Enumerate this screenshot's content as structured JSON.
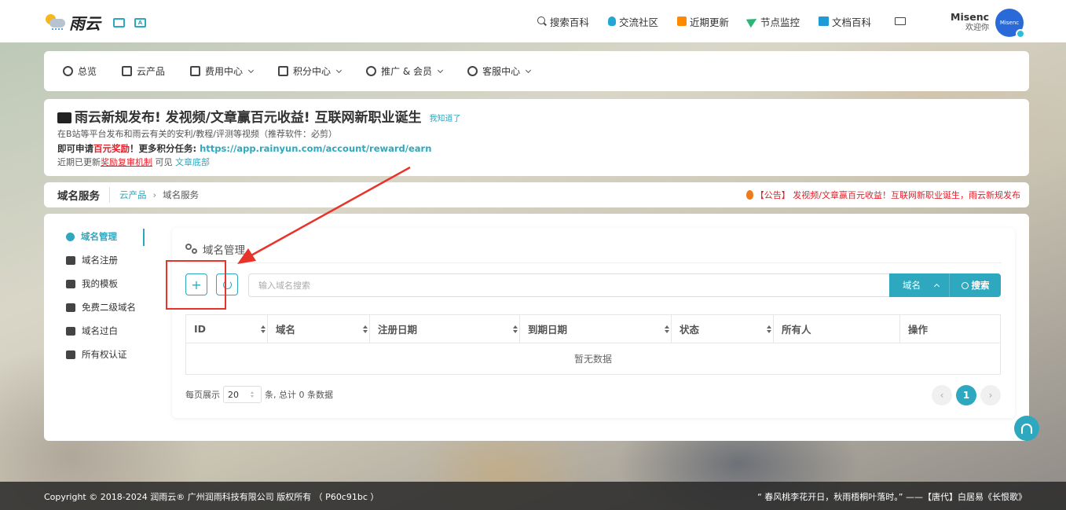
{
  "brand": {
    "name": "雨云"
  },
  "topnav": {
    "items": [
      {
        "label": "搜索百科",
        "icon": "search-icon"
      },
      {
        "label": "交流社区",
        "icon": "qq-icon"
      },
      {
        "label": "近期更新",
        "icon": "update-icon"
      },
      {
        "label": "节点监控",
        "icon": "send-icon"
      },
      {
        "label": "文档百科",
        "icon": "book-icon"
      }
    ],
    "mail_icon": "mail-icon"
  },
  "user": {
    "name": "Misenc",
    "greeting": "欢迎你",
    "avatar_text": "Misenc"
  },
  "mainnav": {
    "items": [
      {
        "label": "总览",
        "dropdown": false
      },
      {
        "label": "云产品",
        "dropdown": false
      },
      {
        "label": "费用中心",
        "dropdown": true
      },
      {
        "label": "积分中心",
        "dropdown": true
      },
      {
        "label": "推广 & 会员",
        "dropdown": true
      },
      {
        "label": "客服中心",
        "dropdown": true
      }
    ]
  },
  "notice": {
    "title": "雨云新规发布! 发视频/文章赢百元收益! 互联网新职业诞生",
    "dismiss": "我知道了",
    "line1": "在B站等平台发布和雨云有关的安利/教程/评测等视频（推荐软件：必剪）",
    "line2_a": "即可申请",
    "line2_red": "百元奖励",
    "line2_b": "！更多积分任务: ",
    "line2_link": "https://app.rainyun.com/account/reward/earn",
    "line3_a": "近期已更新",
    "line3_red": "奖励复审机制",
    "line3_b": " 可见 ",
    "line3_link": "文章底部"
  },
  "breadcrumb": {
    "title": "域名服务",
    "parent": "云产品",
    "separator": "›",
    "current": "域名服务",
    "announcement": "【公告】 发视频/文章赢百元收益！互联网新职业诞生，雨云新规发布"
  },
  "sidemenu": {
    "items": [
      {
        "label": "域名管理",
        "active": true
      },
      {
        "label": "域名注册",
        "active": false
      },
      {
        "label": "我的模板",
        "active": false
      },
      {
        "label": "免费二级域名",
        "active": false
      },
      {
        "label": "域名过白",
        "active": false
      },
      {
        "label": "所有权认证",
        "active": false
      }
    ]
  },
  "panel": {
    "title": "域名管理",
    "add_label": "+",
    "search_placeholder": "输入域名搜索",
    "field_select": "域名",
    "search_button": "搜索"
  },
  "table": {
    "columns": [
      "ID",
      "域名",
      "注册日期",
      "到期日期",
      "状态",
      "所有人",
      "操作"
    ],
    "sortable": [
      true,
      true,
      true,
      true,
      true,
      false,
      false
    ],
    "empty_text": "暂无数据"
  },
  "pagination": {
    "per_page_label": "每页展示",
    "per_page": "20",
    "total_text": "条, 总计 0 条数据",
    "current_page": "1",
    "prev": "‹",
    "next": "›"
  },
  "footer": {
    "copyright": "Copyright © 2018-2024 润雨云® 广州润雨科技有限公司 版权所有 （ P60c91bc ）",
    "poem": "“ 春风桃李花开日，秋雨梧桐叶落时。” ——【唐代】白居易《长恨歌》"
  },
  "colors": {
    "accent": "#2ea8bf",
    "danger": "#e0202a",
    "annotation": "#e8332a"
  }
}
